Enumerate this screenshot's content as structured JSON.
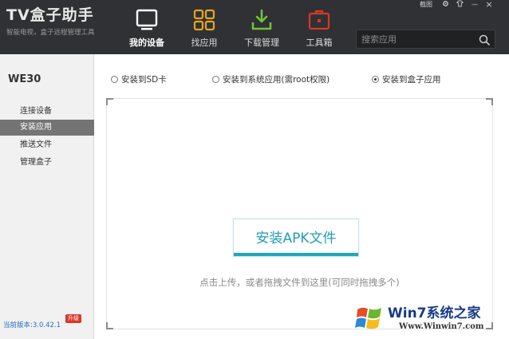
{
  "app": {
    "title": "TV盒子助手",
    "subtitle": "智能电视，盒子远程管理工具"
  },
  "nav": [
    {
      "label": "我的设备",
      "icon": "tv-icon",
      "active": true
    },
    {
      "label": "找应用",
      "icon": "grid-icon",
      "active": false
    },
    {
      "label": "下载管理",
      "icon": "download-icon",
      "active": false
    },
    {
      "label": "工具箱",
      "icon": "toolbox-icon",
      "active": false
    }
  ],
  "window_controls": {
    "screenshot": "截图",
    "settings_icon": "gear-icon",
    "skin_icon": "shirt-icon",
    "minimize": "—",
    "close": "×"
  },
  "search": {
    "placeholder": "搜索应用",
    "icon": "search-icon"
  },
  "sidebar": {
    "device_name": "WE30",
    "items": [
      {
        "label": "连接设备",
        "active": false
      },
      {
        "label": "安装应用",
        "active": true
      },
      {
        "label": "推送文件",
        "active": false
      },
      {
        "label": "管理盒子",
        "active": false
      }
    ],
    "version": "当前版本:3.0.42.1",
    "upgrade_badge": "升级"
  },
  "install_options": [
    {
      "label": "安装到SD卡",
      "checked": false
    },
    {
      "label": "安装到系统应用(需root权限)",
      "checked": false
    },
    {
      "label": "安装到盒子应用",
      "checked": true
    }
  ],
  "dropzone": {
    "button_label": "安装APK文件",
    "hint": "点击上传，或者拖拽文件到这里(可同时拖拽多个)"
  },
  "watermark": {
    "title": "Win7系统之家",
    "url": "Www.Winwin7.com"
  },
  "colors": {
    "header_bg": "#2f3134",
    "accent": "#21a6be",
    "nav_icon_active": "#ffffff",
    "nav_icon_apps": "#e8a51f",
    "nav_icon_download": "#6fc23a",
    "nav_icon_toolbox": "#d9372b"
  }
}
